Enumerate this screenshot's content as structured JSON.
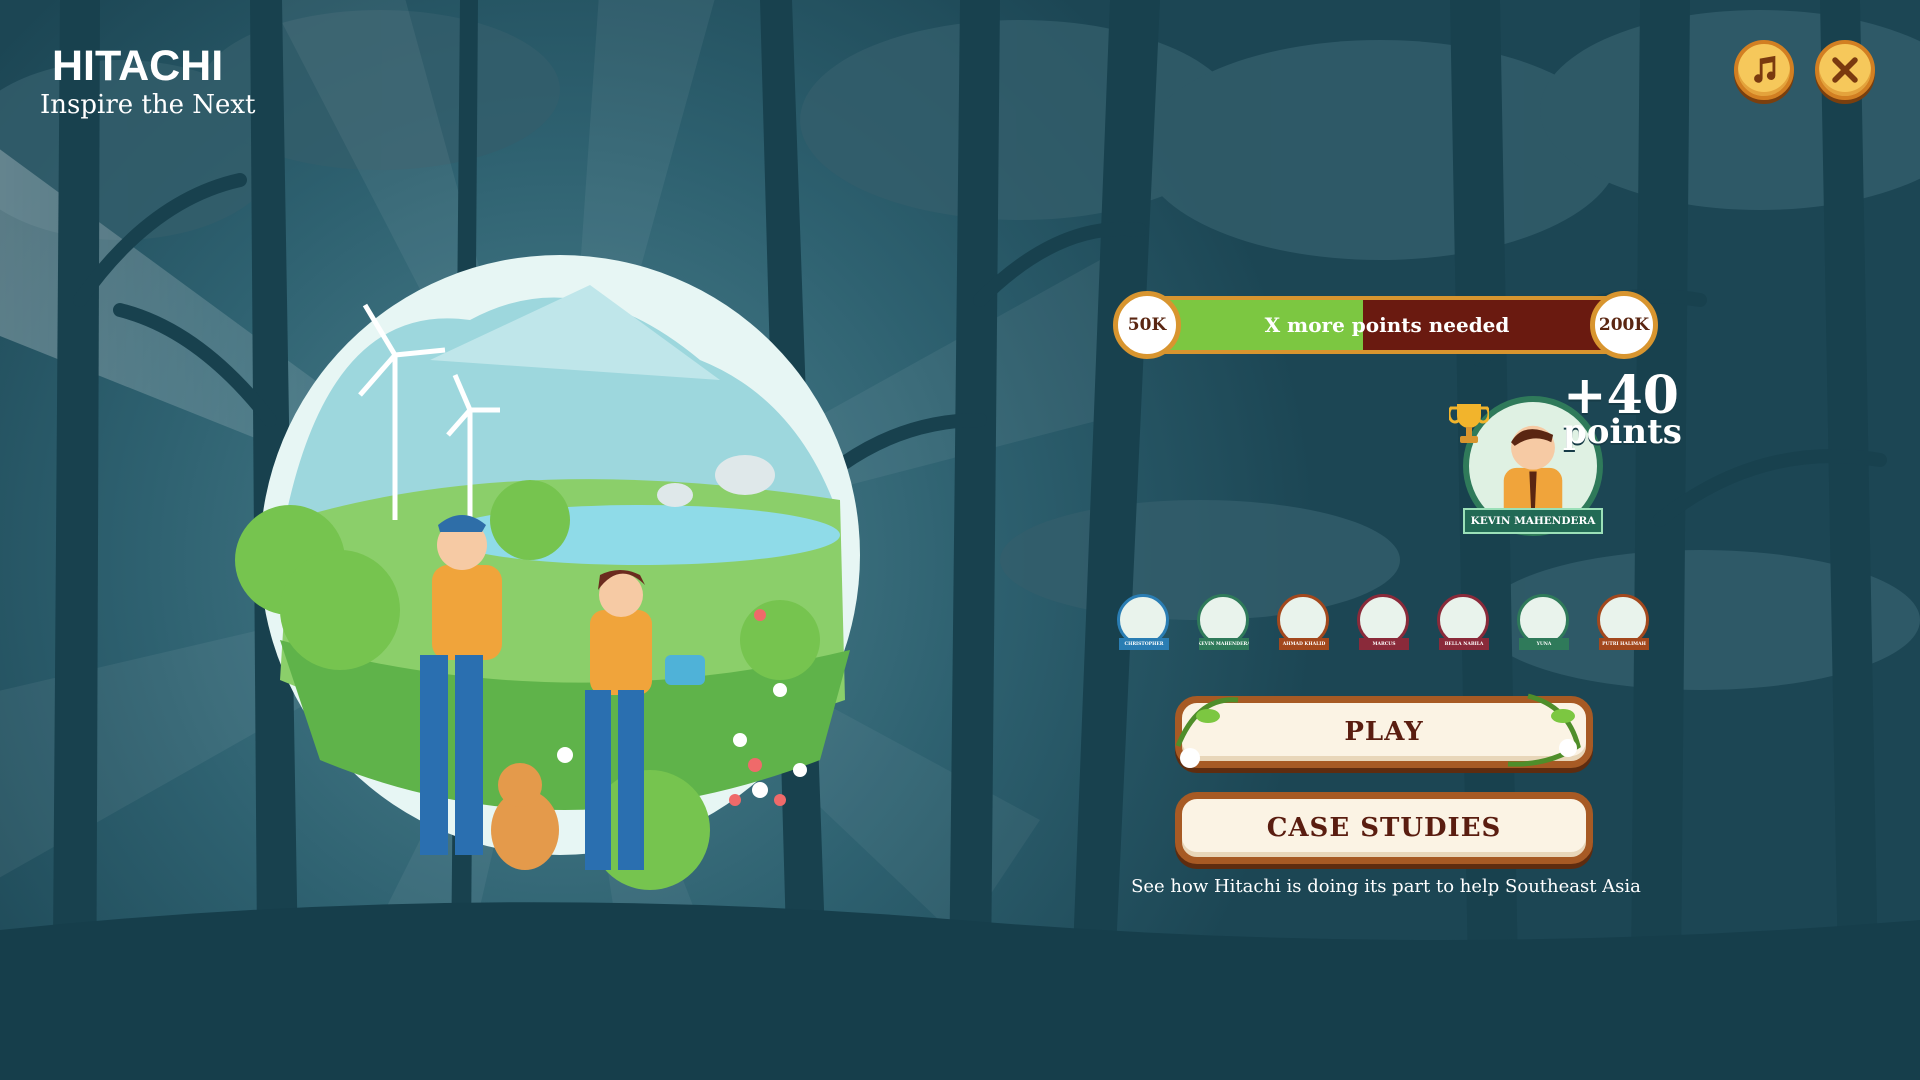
{
  "brand": {
    "name": "HITACHI",
    "tagline": "Inspire the Next"
  },
  "controls": {
    "music_icon": "music-note-icon",
    "close_icon": "close-icon"
  },
  "progress": {
    "min_label": "50K",
    "max_label": "200K",
    "message": "X more points needed",
    "fill_fraction": 0.45
  },
  "featured_player": {
    "name": "KEVIN MAHENDERA",
    "points_value": "+40",
    "points_label": "points"
  },
  "players": [
    {
      "name": "CHRISTOPHER"
    },
    {
      "name": "KEVIN MAHENDERA"
    },
    {
      "name": "AHMAD KHALID"
    },
    {
      "name": "MARCUS"
    },
    {
      "name": "BELLA NABILA"
    },
    {
      "name": "YUNA"
    },
    {
      "name": "PUTRI HALIMAH"
    }
  ],
  "buttons": {
    "play": "PLAY",
    "case_studies": "CASE STUDIES"
  },
  "caption": "See how Hitachi is doing its part to help Southeast Asia",
  "colors": {
    "background": "#1f4f5e",
    "progress_fill": "#7cc741",
    "progress_track": "#6a1a10",
    "button_frame": "#a75a24",
    "button_text": "#5a1d10",
    "round_button": "#f6c85b"
  }
}
